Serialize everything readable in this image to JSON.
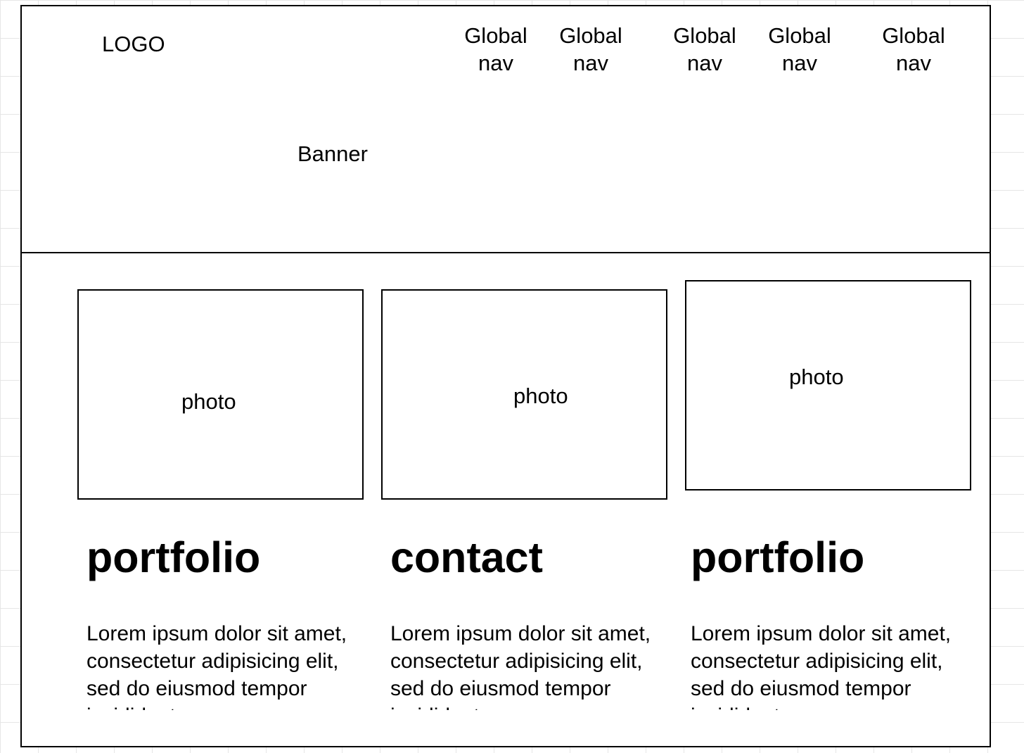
{
  "header": {
    "logo": "LOGO",
    "banner": "Banner",
    "nav": [
      {
        "line1": "Global",
        "line2": "nav"
      },
      {
        "line1": "Global",
        "line2": "nav"
      },
      {
        "line1": "Global",
        "line2": "nav"
      },
      {
        "line1": "Global",
        "line2": "nav"
      },
      {
        "line1": "Global",
        "line2": "nav"
      }
    ]
  },
  "cards": [
    {
      "photo": "photo",
      "heading": "portfolio",
      "body": "Lorem ipsum dolor sit amet, consectetur adipisicing elit, sed do eiusmod tempor incididunt"
    },
    {
      "photo": "photo",
      "heading": "contact",
      "body": "Lorem ipsum dolor sit amet, consectetur adipisicing elit, sed do eiusmod tempor incididunt"
    },
    {
      "photo": "photo",
      "heading": "portfolio",
      "body": "Lorem ipsum dolor sit amet, consectetur adipisicing elit, sed do eiusmod tempor incididunt"
    }
  ]
}
